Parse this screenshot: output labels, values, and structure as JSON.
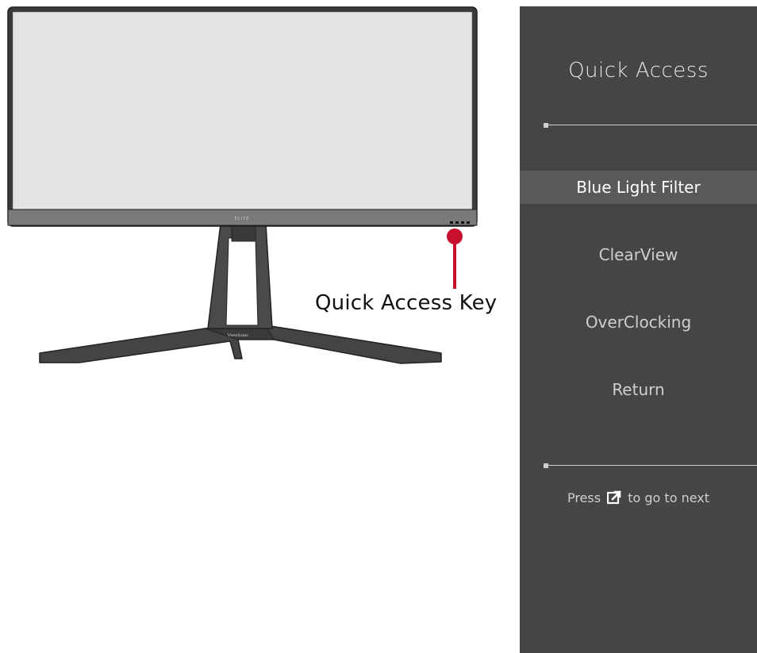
{
  "callout": {
    "label": "Quick Access Key"
  },
  "monitor": {
    "bezel_text": "ELITE",
    "stand_logo": "ViewSonic"
  },
  "osd": {
    "title": "Quick Access",
    "menu": [
      {
        "label": "Blue Light Filter",
        "selected": true
      },
      {
        "label": "ClearView",
        "selected": false
      },
      {
        "label": "OverClocking",
        "selected": false
      },
      {
        "label": "Return",
        "selected": false
      }
    ],
    "hint": {
      "prefix": "Press",
      "icon": "quick-access-key-icon",
      "suffix": "to go to next"
    }
  },
  "colors": {
    "osd_background": "#454545",
    "osd_selected": "#595959",
    "callout_red": "#c8102e",
    "monitor_frame": "#3a3a3a",
    "screen": "#e3e3e3"
  }
}
